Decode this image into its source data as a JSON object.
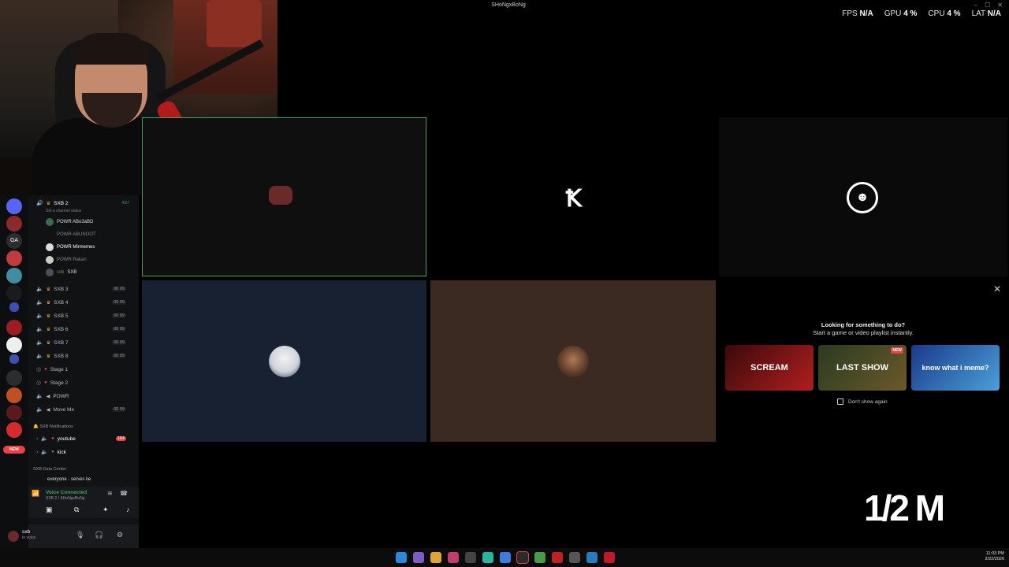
{
  "window": {
    "title": "SHoNgxBoNg"
  },
  "perf": {
    "fps_label": "FPS",
    "fps_value": "N/A",
    "gpu_label": "GPU",
    "gpu_value": "4 %",
    "cpu_label": "CPU",
    "cpu_value": "4 %",
    "lat_label": "LAT",
    "lat_value": "N/A"
  },
  "sidebar": {
    "current_channel": {
      "name": "SXB 2",
      "time": "4:57",
      "status": "Set a channel status"
    },
    "voice_users": [
      {
        "name": "POWR ABo3aBD"
      },
      {
        "name": "POWR ABUNOOT"
      },
      {
        "name": "POWR Mirmemes"
      },
      {
        "name": "POWR Rakan"
      },
      {
        "name": "sxb",
        "tag": "SXB"
      }
    ],
    "voice_channels": [
      {
        "name": "SXB 3",
        "count": "00 99"
      },
      {
        "name": "SXB 4",
        "count": "00 99"
      },
      {
        "name": "SXB 5",
        "count": "00 99"
      },
      {
        "name": "SXB 6",
        "count": "00 99"
      },
      {
        "name": "SXB 7",
        "count": "00 99"
      },
      {
        "name": "SXB 8",
        "count": "00 99"
      },
      {
        "name": "Stage 1",
        "count": ""
      },
      {
        "name": "Stage 2",
        "count": ""
      },
      {
        "name": "POWR",
        "count": ""
      },
      {
        "name": "Move Me",
        "count": "00 99"
      }
    ],
    "category_notifications": "SXB Notifications",
    "text_channels": [
      {
        "name": "youtube",
        "badge": "164"
      },
      {
        "name": "kick",
        "badge": ""
      }
    ],
    "category_data": "SXB Data Center",
    "partial_channel": "everyone · server-ne",
    "voice_panel": {
      "status": "Voice Connected",
      "location": "SXB 2 / SHoNgxBoNg"
    },
    "user_panel": {
      "name": "sxb",
      "status": "In voice"
    }
  },
  "rail": {
    "new_badge": "NEW"
  },
  "promo": {
    "title": "Looking for something to do?",
    "subtitle": "Start a game or video playlist instantly.",
    "cards": [
      {
        "label": "SCREAM"
      },
      {
        "label": "LAST SHOW",
        "badge": "NEW"
      },
      {
        "label": "know what i meme?"
      }
    ],
    "checkbox_label": "Don't show again"
  },
  "overlay": {
    "sub_count": "1/2 M"
  },
  "taskbar": {
    "time": "11:03 PM",
    "date": "2/22/2026"
  },
  "colors": {
    "speaking_border": "#3ba55d",
    "tile4_bg": "#172132",
    "tile5_bg": "#3a2a22",
    "new_badge": "#ed4245"
  }
}
